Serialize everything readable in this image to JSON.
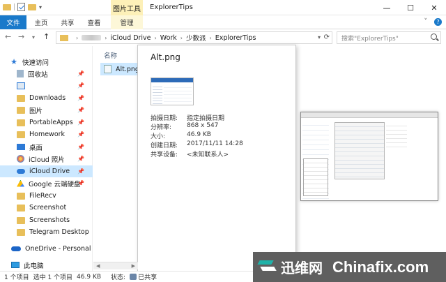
{
  "titlebar": {
    "context_tab": "图片工具",
    "window_title": "ExplorerTips",
    "minimize": "—",
    "maximize": "☐",
    "close": "✕"
  },
  "ribbon": {
    "tabs": [
      {
        "label": "文件"
      },
      {
        "label": "主页"
      },
      {
        "label": "共享"
      },
      {
        "label": "查看"
      },
      {
        "label": "管理"
      }
    ],
    "collapse_glyph": "˅",
    "help_glyph": "?"
  },
  "address": {
    "crumbs": [
      "iCloud Drive",
      "Work",
      "少数派",
      "ExplorerTips"
    ],
    "search_placeholder": "搜索\"ExplorerTips\""
  },
  "sidebar": {
    "quick_access": "快速访问",
    "items": [
      {
        "label": "回收站",
        "pinned": true
      },
      {
        "label": "",
        "pinned": true
      },
      {
        "label": "Downloads",
        "pinned": true
      },
      {
        "label": "图片",
        "pinned": true
      },
      {
        "label": "PortableApps",
        "pinned": true
      },
      {
        "label": "Homework",
        "pinned": true
      },
      {
        "label": "桌面",
        "pinned": true
      },
      {
        "label": "iCloud 照片",
        "pinned": true
      },
      {
        "label": "iCloud Drive",
        "pinned": true
      },
      {
        "label": "Google 云端硬盘",
        "pinned": true
      },
      {
        "label": "FileRecv",
        "pinned": false
      },
      {
        "label": "Screenshot",
        "pinned": false
      },
      {
        "label": "Screenshots",
        "pinned": false
      },
      {
        "label": "Telegram Desktop",
        "pinned": false
      }
    ],
    "onedrive": "OneDrive - Personal",
    "this_pc": "此电脑"
  },
  "main": {
    "column_header": "名称",
    "file_name": "Alt.png"
  },
  "preview": {
    "title": "Alt.png",
    "props": [
      {
        "k": "拍摄日期:",
        "v": "指定拍摄日期"
      },
      {
        "k": "分辨率:",
        "v": "868 x 547"
      },
      {
        "k": "大小:",
        "v": "46.9 KB"
      },
      {
        "k": "创建日期:",
        "v": "2017/11/11 14:28"
      },
      {
        "k": "共享设备:",
        "v": "<未知联系人>"
      }
    ]
  },
  "status": {
    "count": "1 个项目",
    "selected": "选中 1 个项目",
    "size": "46.9 KB",
    "state_label": "状态:",
    "state_value": "已共享"
  },
  "watermark": {
    "cn": "迅维网",
    "en": "Chinafix.com"
  },
  "colors": {
    "accent": "#1979ca",
    "selection": "#cce8ff",
    "context_tab": "#fdf0b8",
    "folder": "#e8bf5a"
  }
}
